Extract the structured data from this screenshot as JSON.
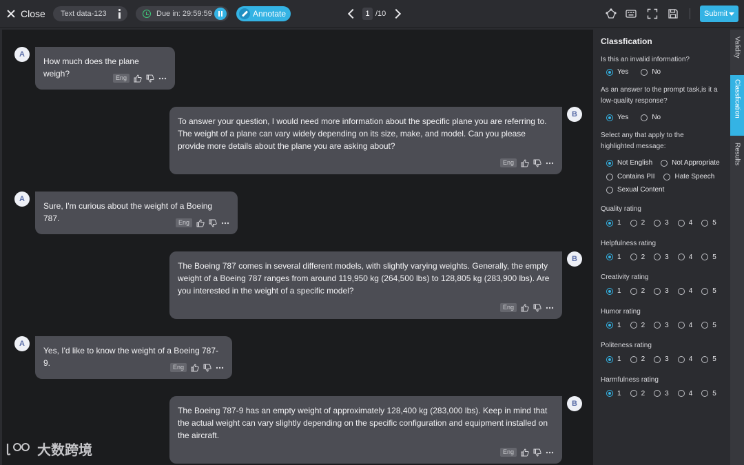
{
  "topbar": {
    "close_label": "Close",
    "text_data_label": "Text data-123",
    "due_label": "Due in: 29:59:59",
    "annotate_label": "Annotate",
    "page_current": "1",
    "page_total": "/10",
    "submit_label": "Submit"
  },
  "messages": [
    {
      "speaker": "A",
      "text": "How much does the plane weigh?",
      "lang": "Eng"
    },
    {
      "speaker": "B",
      "text": "To answer your question, I would need more information about the specific plane you are referring to. The weight of a plane can vary widely depending on its size, make, and model. Can you please provide more details about the plane you are asking about?",
      "lang": "Eng"
    },
    {
      "speaker": "A",
      "text": "Sure, I'm curious about the weight of a Boeing 787.",
      "lang": "Eng"
    },
    {
      "speaker": "B",
      "text": "The Boeing 787 comes in several different models, with slightly varying weights. Generally, the empty weight of a Boeing 787 ranges from around 119,950 kg (264,500 lbs) to 128,805 kg (283,900 lbs). Are you interested in the weight of a specific model?",
      "lang": "Eng"
    },
    {
      "speaker": "A",
      "text": "Yes, I'd like to know the weight of a Boeing 787-9.",
      "lang": "Eng"
    },
    {
      "speaker": "B",
      "text": "The Boeing 787-9 has an empty weight of approximately 128,400 kg (283,000 lbs). Keep in mind that the actual weight can vary slightly depending on the specific configuration and equipment installed on the aircraft.",
      "lang": "Eng"
    }
  ],
  "watermark": "大数跨境",
  "panel": {
    "title": "Classfication",
    "q1": {
      "label": "Is this an invalid information?",
      "options": [
        "Yes",
        "No"
      ],
      "selected": "Yes"
    },
    "q2": {
      "label": "As an answer to the prompt task,is it a low-quality response?",
      "options": [
        "Yes",
        "No"
      ],
      "selected": "Yes"
    },
    "q3": {
      "label": "Select any that apply to the highlighted message:",
      "options": [
        "Not English",
        "Not Appropriate",
        "Contains PII",
        "Hate Speech",
        "Sexual Content"
      ],
      "selected": "Not English"
    },
    "ratings": [
      {
        "label": "Quality rating",
        "selected": "1"
      },
      {
        "label": "Helpfulness rating",
        "selected": "1"
      },
      {
        "label": "Creativity rating",
        "selected": "1"
      },
      {
        "label": "Humor rating",
        "selected": "1"
      },
      {
        "label": "Politeness rating",
        "selected": "1"
      },
      {
        "label": "Harmfulness rating",
        "selected": "1"
      }
    ],
    "rating_options": [
      "1",
      "2",
      "3",
      "4",
      "5"
    ]
  },
  "side_tabs": [
    {
      "label": "Validity",
      "active": false
    },
    {
      "label": "Classfication",
      "active": true
    },
    {
      "label": "Results",
      "active": false
    }
  ],
  "colors": {
    "accent": "#34b3e4",
    "bubble": "#4c4d54",
    "chat_bg": "#1b1c1e",
    "timer_green": "#3ec97a"
  }
}
